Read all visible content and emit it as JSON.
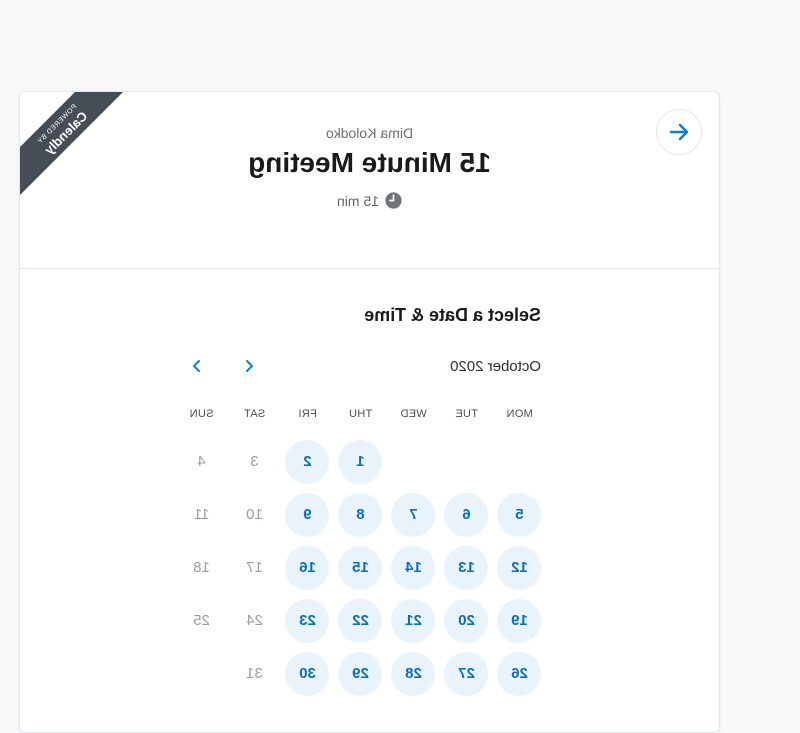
{
  "ribbon": {
    "powered_by": "POWERED BY",
    "brand": "Calendly"
  },
  "event": {
    "owner": "Dima Kolodko",
    "title": "15 Minute Meeting",
    "duration": "15 min"
  },
  "scheduler": {
    "heading": "Select a Date & Time",
    "month": "October 2020"
  },
  "weekdays": [
    "MON",
    "TUE",
    "WED",
    "THU",
    "FRI",
    "SAT",
    "SUN"
  ],
  "weeks": [
    [
      {
        "day": "",
        "available": false
      },
      {
        "day": "",
        "available": false
      },
      {
        "day": "",
        "available": false
      },
      {
        "day": "1",
        "available": true
      },
      {
        "day": "2",
        "available": true
      },
      {
        "day": "3",
        "available": false
      },
      {
        "day": "4",
        "available": false
      }
    ],
    [
      {
        "day": "5",
        "available": true
      },
      {
        "day": "6",
        "available": true
      },
      {
        "day": "7",
        "available": true
      },
      {
        "day": "8",
        "available": true
      },
      {
        "day": "9",
        "available": true
      },
      {
        "day": "10",
        "available": false
      },
      {
        "day": "11",
        "available": false
      }
    ],
    [
      {
        "day": "12",
        "available": true
      },
      {
        "day": "13",
        "available": true
      },
      {
        "day": "14",
        "available": true
      },
      {
        "day": "15",
        "available": true
      },
      {
        "day": "16",
        "available": true
      },
      {
        "day": "17",
        "available": false
      },
      {
        "day": "18",
        "available": false
      }
    ],
    [
      {
        "day": "19",
        "available": true
      },
      {
        "day": "20",
        "available": true
      },
      {
        "day": "21",
        "available": true
      },
      {
        "day": "22",
        "available": true
      },
      {
        "day": "23",
        "available": true
      },
      {
        "day": "24",
        "available": false
      },
      {
        "day": "25",
        "available": false
      }
    ],
    [
      {
        "day": "26",
        "available": true
      },
      {
        "day": "27",
        "available": true
      },
      {
        "day": "28",
        "available": true
      },
      {
        "day": "29",
        "available": true
      },
      {
        "day": "30",
        "available": true
      },
      {
        "day": "31",
        "available": false
      },
      {
        "day": "",
        "available": false
      }
    ]
  ],
  "colors": {
    "accent": "#0a7fd6",
    "available_bg": "#e8f3fc",
    "ribbon_bg": "#474d56"
  },
  "icons": {
    "back": "arrow-left-icon",
    "clock": "clock-icon",
    "prev": "chevron-left-icon",
    "next": "chevron-right-icon"
  }
}
